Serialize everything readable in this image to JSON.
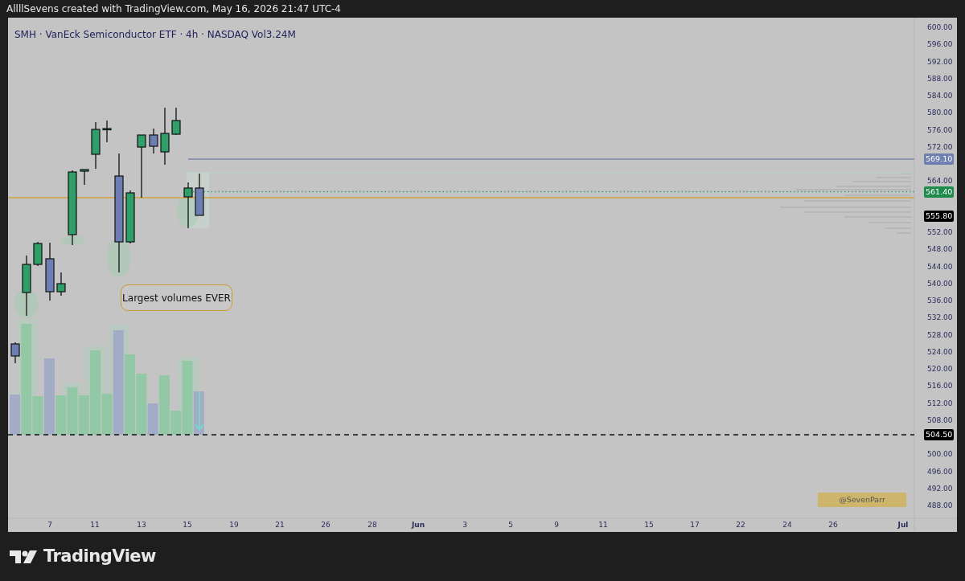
{
  "header": {
    "title": "AllllSevens created with TradingView.com, May 16, 2026 21:47 UTC-4"
  },
  "chart": {
    "legend": "SMH · VanEck Semiconductor ETF · 4h · NASDAQ  Vol3.24M",
    "annotation": "Largest volumes EVER",
    "signature": "@SevenParr",
    "price_axis": [
      "600.00",
      "596.00",
      "592.00",
      "588.00",
      "584.00",
      "580.00",
      "576.00",
      "572.00",
      "564.00",
      "552.00",
      "548.00",
      "544.00",
      "540.00",
      "536.00",
      "532.00",
      "528.00",
      "524.00",
      "520.00",
      "516.00",
      "512.00",
      "508.00",
      "500.00",
      "496.00",
      "492.00",
      "488.00"
    ],
    "price_labels": [
      {
        "text": "569.10",
        "color": "#6e7fb0"
      },
      {
        "text": "561.40",
        "color": "#1e8a4c"
      },
      {
        "text": "555.80",
        "color": "#000000"
      },
      {
        "text": "504.50",
        "color": "#000000"
      }
    ],
    "time_axis": [
      {
        "text": "7",
        "kind": "day"
      },
      {
        "text": "11",
        "kind": "day"
      },
      {
        "text": "13",
        "kind": "day"
      },
      {
        "text": "15",
        "kind": "day"
      },
      {
        "text": "19",
        "kind": "day"
      },
      {
        "text": "21",
        "kind": "day"
      },
      {
        "text": "26",
        "kind": "day"
      },
      {
        "text": "28",
        "kind": "day"
      },
      {
        "text": "Jun",
        "kind": "month"
      },
      {
        "text": "3",
        "kind": "day"
      },
      {
        "text": "5",
        "kind": "day"
      },
      {
        "text": "9",
        "kind": "day"
      },
      {
        "text": "11",
        "kind": "day"
      },
      {
        "text": "15",
        "kind": "day"
      },
      {
        "text": "17",
        "kind": "day"
      },
      {
        "text": "22",
        "kind": "day"
      },
      {
        "text": "24",
        "kind": "day"
      },
      {
        "text": "26",
        "kind": "day"
      },
      {
        "text": "Jul",
        "kind": "month"
      }
    ]
  },
  "footer": {
    "logo": "TradingView"
  }
}
